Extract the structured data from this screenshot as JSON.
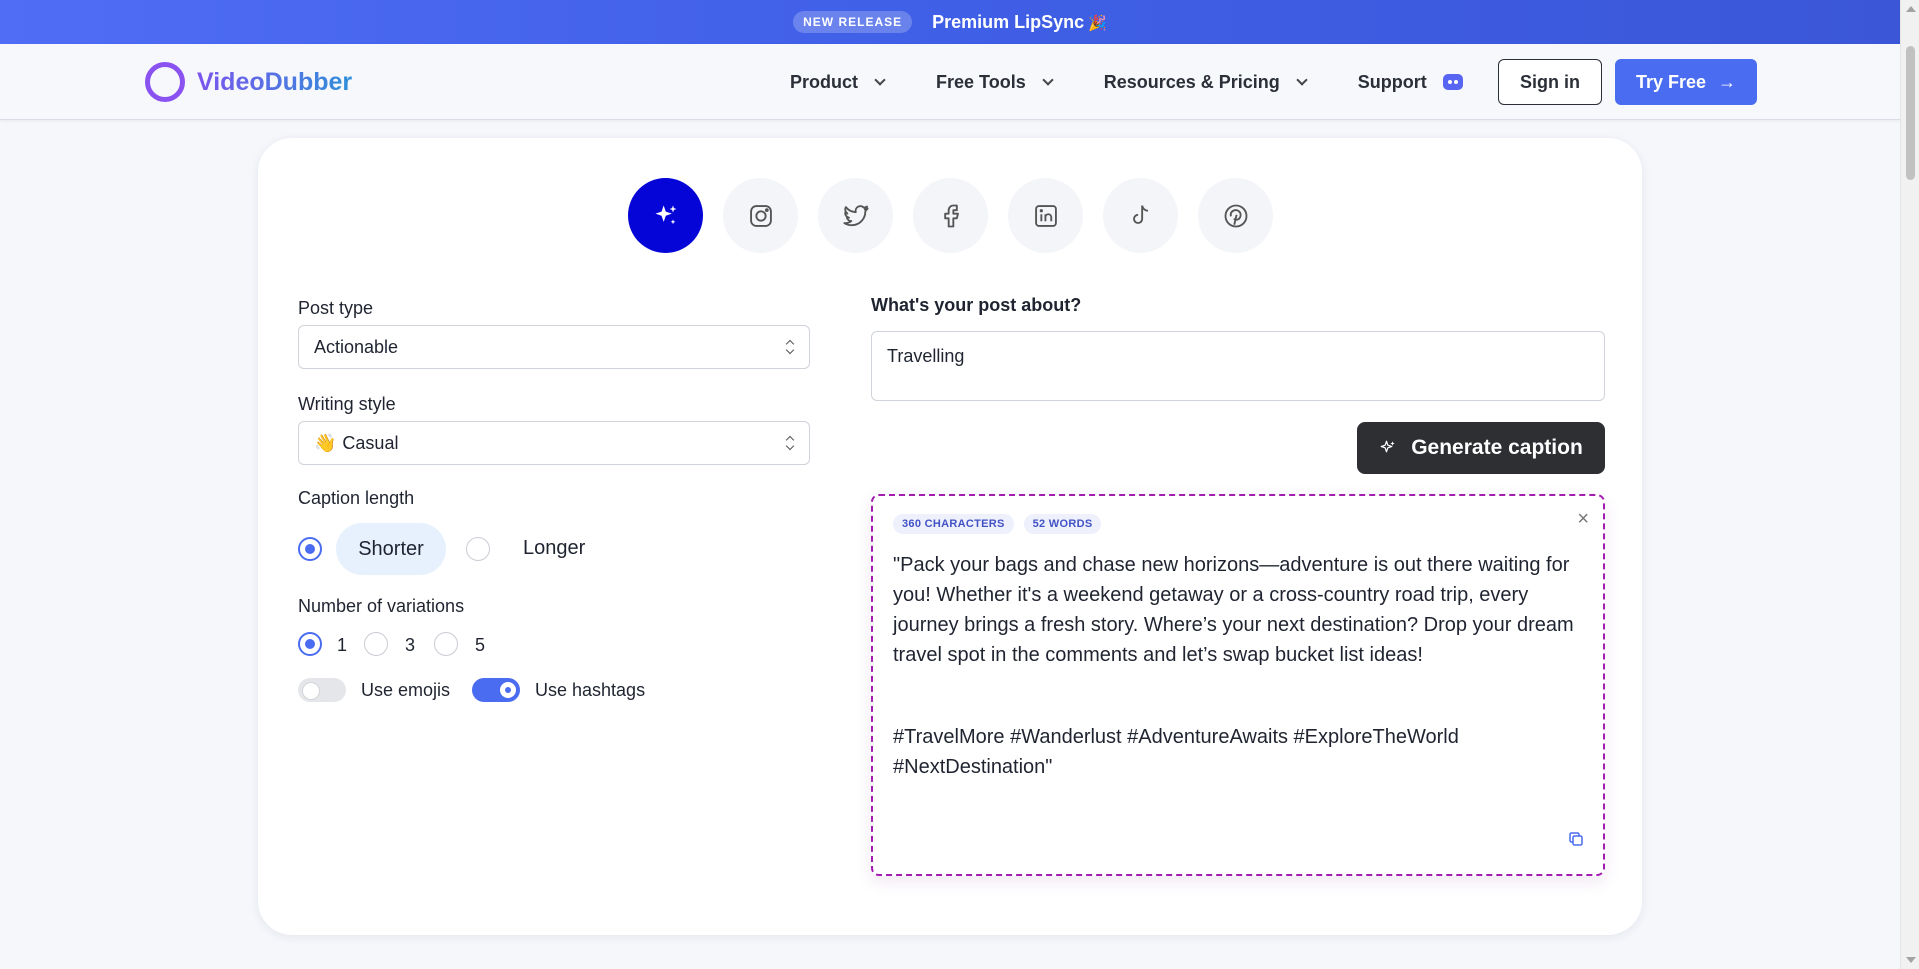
{
  "banner": {
    "badge": "NEW RELEASE",
    "text": "Premium LipSync",
    "emoji": "🎉"
  },
  "nav": {
    "logo": "VideoDubber",
    "menu": [
      {
        "label": "Product"
      },
      {
        "label": "Free Tools"
      },
      {
        "label": "Resources & Pricing"
      },
      {
        "label": "Support"
      }
    ],
    "sign_in": "Sign in",
    "try_free": "Try Free",
    "try_free_arrow": "→"
  },
  "platforms": [
    "sparkles-icon",
    "instagram-icon",
    "twitter-icon",
    "facebook-icon",
    "linkedin-icon",
    "tiktok-icon",
    "pinterest-icon"
  ],
  "form": {
    "post_type_label": "Post type",
    "post_type_value": "Actionable",
    "writing_style_label": "Writing style",
    "writing_style_emoji": "👋",
    "writing_style_value": "Casual",
    "caption_length_label": "Caption length",
    "caption_length_options": [
      "Shorter",
      "Longer"
    ],
    "caption_length_selected": "Shorter",
    "variations_label": "Number of variations",
    "variations_options": [
      "1",
      "3",
      "5"
    ],
    "variations_selected": "1",
    "use_emojis_label": "Use emojis",
    "use_emojis": false,
    "use_hashtags_label": "Use hashtags",
    "use_hashtags": true
  },
  "post": {
    "about_label": "What's your post about?",
    "about_value": "Travelling",
    "generate_label": "Generate caption"
  },
  "result": {
    "characters": "360 CHARACTERS",
    "words": "52 WORDS",
    "caption": "\"Pack your bags and chase new horizons—adventure is out there waiting for you! Whether it's a weekend getaway or a cross-country road trip, every journey brings a fresh story. Where’s your next destination? Drop your dream travel spot in the comments and let’s swap bucket list ideas!",
    "hashtags": "#TravelMore #Wanderlust #AdventureAwaits #ExploreTheWorld #NextDestination\"",
    "close": "×"
  },
  "colors": {
    "accent": "#4a6cf0",
    "active_platform": "#0505d8",
    "result_border": "#a21caf",
    "dark_button": "#2d2f33"
  }
}
